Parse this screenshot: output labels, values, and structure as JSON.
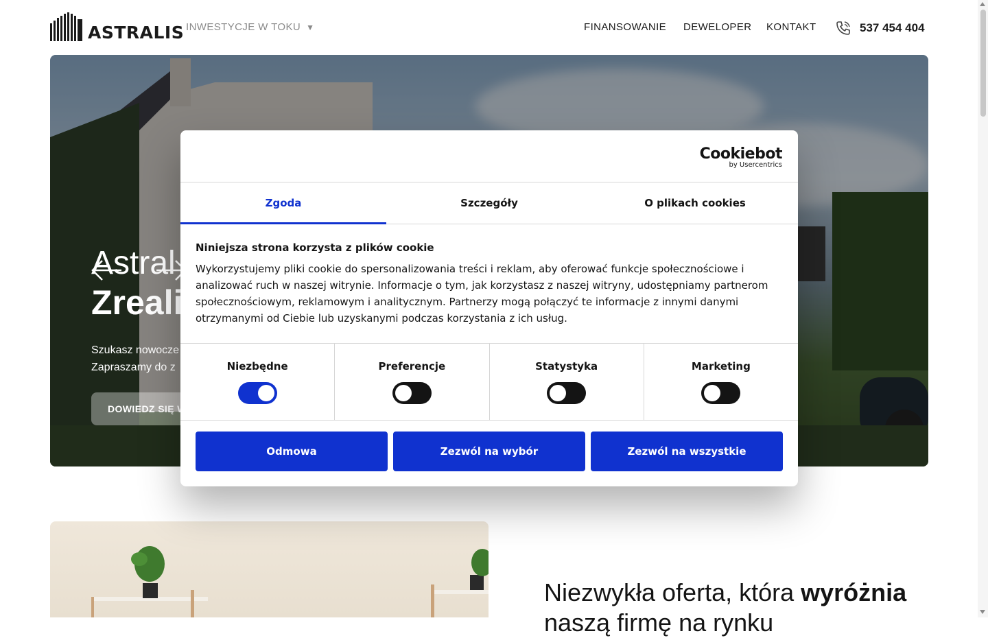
{
  "header": {
    "logo_text": "ASTRALIS",
    "nav_invest": "INWESTYCJE W TOKU",
    "nav_financing": "FINANSOWANIE",
    "nav_developer": "DEWELOPER",
    "nav_contact": "KONTAKT",
    "phone": "537 454 404",
    "caret": "▼"
  },
  "hero": {
    "title_line1": "Astral",
    "title_line2": "Zreali",
    "text_line1": "Szukasz nowocze",
    "text_line2": "Zapraszamy do z",
    "button": "DOWIEDZ SIĘ W"
  },
  "section": {
    "offer_title_regular": "Niezwykła oferta, która ",
    "offer_title_bold": "wyróżnia",
    "offer_title_line2": "naszą firmę na rynku"
  },
  "cookie_dialog": {
    "brand": "Cookiebot",
    "brand_sub": "by Usercentrics",
    "tabs": [
      "Zgoda",
      "Szczegóły",
      "O plikach cookies"
    ],
    "active_tab": "Zgoda",
    "title": "Niniejsza strona korzysta z plików cookie",
    "body": "Wykorzystujemy pliki cookie do spersonalizowania treści i reklam, aby oferować funkcje społecznościowe i analizować ruch w naszej witrynie. Informacje o tym, jak korzystasz z naszej witryny, udostępniamy partnerom społecznościowym, reklamowym i analitycznym. Partnerzy mogą połączyć te informacje z innymi danymi otrzymanymi od Ciebie lub uzyskanymi podczas korzystania z ich usług.",
    "categories": [
      {
        "label": "Niezbędne",
        "enabled": true
      },
      {
        "label": "Preferencje",
        "enabled": false
      },
      {
        "label": "Statystyka",
        "enabled": false
      },
      {
        "label": "Marketing",
        "enabled": false
      }
    ],
    "buttons": [
      "Odmowa",
      "Zezwól na wybór",
      "Zezwól na wszystkie"
    ]
  },
  "colors": {
    "accent": "#1032cf",
    "toggle_off": "#141414",
    "text": "#141414"
  },
  "icons": [
    "astralis-logo-icon",
    "phone-icon",
    "arrow-left-icon",
    "arrow-right-icon",
    "chevron-down-icon"
  ]
}
